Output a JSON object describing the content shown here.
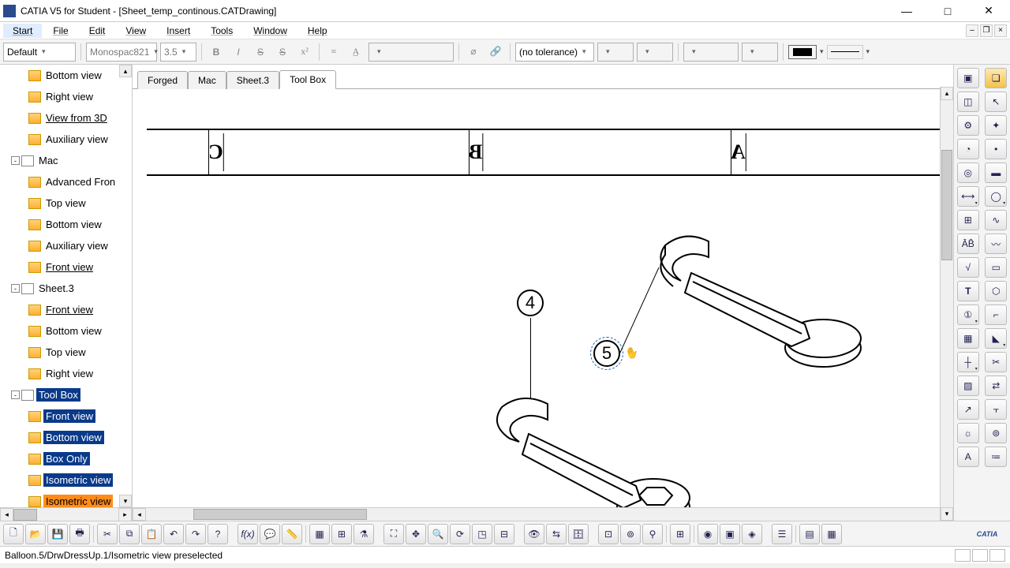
{
  "app": {
    "title": "CATIA V5 for Student - [Sheet_temp_continous.CATDrawing]"
  },
  "menu": {
    "items": [
      "Start",
      "File",
      "Edit",
      "View",
      "Insert",
      "Tools",
      "Window",
      "Help"
    ]
  },
  "fmt": {
    "style": "Default",
    "font": "Monospac821",
    "size": "3.5",
    "tol": "(no tolerance)"
  },
  "tree": {
    "items": [
      {
        "indent": 36,
        "icon": "view",
        "label": "Bottom view"
      },
      {
        "indent": 36,
        "icon": "view",
        "label": "Right view"
      },
      {
        "indent": 36,
        "icon": "view",
        "label": "View from 3D",
        "link": true
      },
      {
        "indent": 36,
        "icon": "view",
        "label": "Auxiliary view"
      },
      {
        "indent": 14,
        "exp": "-",
        "icon": "sheet",
        "label": "Mac"
      },
      {
        "indent": 36,
        "icon": "view",
        "label": "Advanced Fron"
      },
      {
        "indent": 36,
        "icon": "view",
        "label": "Top view"
      },
      {
        "indent": 36,
        "icon": "view",
        "label": "Bottom view"
      },
      {
        "indent": 36,
        "icon": "view",
        "label": "Auxiliary view"
      },
      {
        "indent": 36,
        "icon": "view",
        "label": "Front view",
        "link": true
      },
      {
        "indent": 14,
        "exp": "-",
        "icon": "sheet",
        "label": "Sheet.3"
      },
      {
        "indent": 36,
        "icon": "view",
        "label": "Front view",
        "link": true
      },
      {
        "indent": 36,
        "icon": "view",
        "label": "Bottom view"
      },
      {
        "indent": 36,
        "icon": "view",
        "label": "Top view"
      },
      {
        "indent": 36,
        "icon": "view",
        "label": "Right view"
      },
      {
        "indent": 14,
        "exp": "-",
        "icon": "sheet",
        "label": "Tool Box",
        "sel": "blue"
      },
      {
        "indent": 36,
        "icon": "view",
        "label": "Front view",
        "sel": "blue"
      },
      {
        "indent": 36,
        "icon": "view",
        "label": "Bottom view",
        "sel": "blue"
      },
      {
        "indent": 36,
        "icon": "view",
        "label": "Box Only",
        "sel": "blue"
      },
      {
        "indent": 36,
        "icon": "view",
        "label": "Isometric view",
        "sel": "blue"
      },
      {
        "indent": 36,
        "icon": "view",
        "label": "Isometric view",
        "sel": "orange"
      }
    ]
  },
  "tabs": {
    "items": [
      "Forged",
      "Mac",
      "Sheet.3",
      "Tool Box"
    ],
    "active": 3
  },
  "zones": {
    "A": "A",
    "B": "B",
    "C": "C"
  },
  "balloons": {
    "b4": "4",
    "b5": "5"
  },
  "status": {
    "text": "Balloon.5/DrwDressUp.1/Isometric view preselected"
  },
  "bottom_logo": "CATIA"
}
